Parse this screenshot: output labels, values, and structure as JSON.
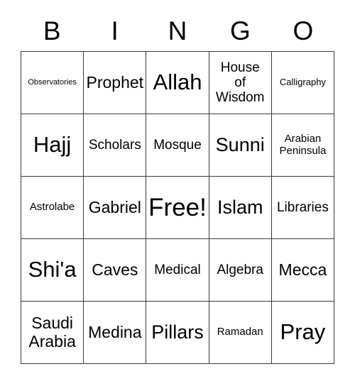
{
  "card": {
    "title_letters": [
      "B",
      "I",
      "N",
      "G",
      "O"
    ],
    "rows": [
      [
        {
          "label": "Observatories",
          "size": "xs"
        },
        {
          "label": "Prophet",
          "size": "xl"
        },
        {
          "label": "Allah",
          "size": "3xl"
        },
        {
          "label": "House\nof\nWisdom",
          "size": "l"
        },
        {
          "label": "Calligraphy",
          "size": "s"
        }
      ],
      [
        {
          "label": "Hajj",
          "size": "3xl"
        },
        {
          "label": "Scholars",
          "size": "l"
        },
        {
          "label": "Mosque",
          "size": "l"
        },
        {
          "label": "Sunni",
          "size": "2xl"
        },
        {
          "label": "Arabian\nPeninsula",
          "size": "m"
        }
      ],
      [
        {
          "label": "Astrolabe",
          "size": "m"
        },
        {
          "label": "Gabriel",
          "size": "xl"
        },
        {
          "label": "Free!",
          "size": "4xl"
        },
        {
          "label": "Islam",
          "size": "2xl"
        },
        {
          "label": "Libraries",
          "size": "l"
        }
      ],
      [
        {
          "label": "Shi'a",
          "size": "3xl"
        },
        {
          "label": "Caves",
          "size": "xl"
        },
        {
          "label": "Medical",
          "size": "l"
        },
        {
          "label": "Algebra",
          "size": "l"
        },
        {
          "label": "Mecca",
          "size": "xl"
        }
      ],
      [
        {
          "label": "Saudi\nArabia",
          "size": "xl"
        },
        {
          "label": "Medina",
          "size": "xl"
        },
        {
          "label": "Pillars",
          "size": "2xl"
        },
        {
          "label": "Ramadan",
          "size": "m"
        },
        {
          "label": "Pray",
          "size": "3xl"
        }
      ]
    ]
  }
}
